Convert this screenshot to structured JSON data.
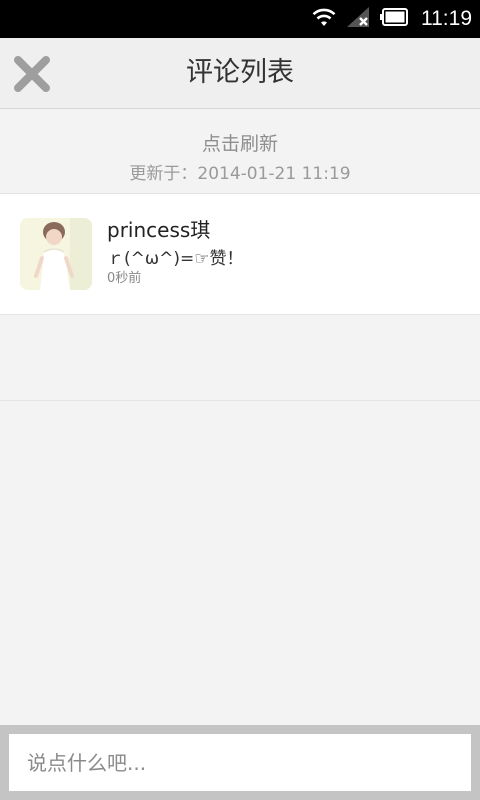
{
  "status_bar": {
    "time": "11:19",
    "icons": [
      "wifi-icon",
      "signal-no-service-icon",
      "battery-icon"
    ]
  },
  "header": {
    "title": "评论列表",
    "close_icon": "close-icon"
  },
  "refresh": {
    "label": "点击刷新",
    "updated_at": "更新于：2014-01-21 11:19"
  },
  "comments": [
    {
      "user": "princess琪",
      "text": "ｒ(^ω^)=☞赞！",
      "time": "0秒前"
    }
  ],
  "composer": {
    "placeholder": "说点什么吧..."
  }
}
